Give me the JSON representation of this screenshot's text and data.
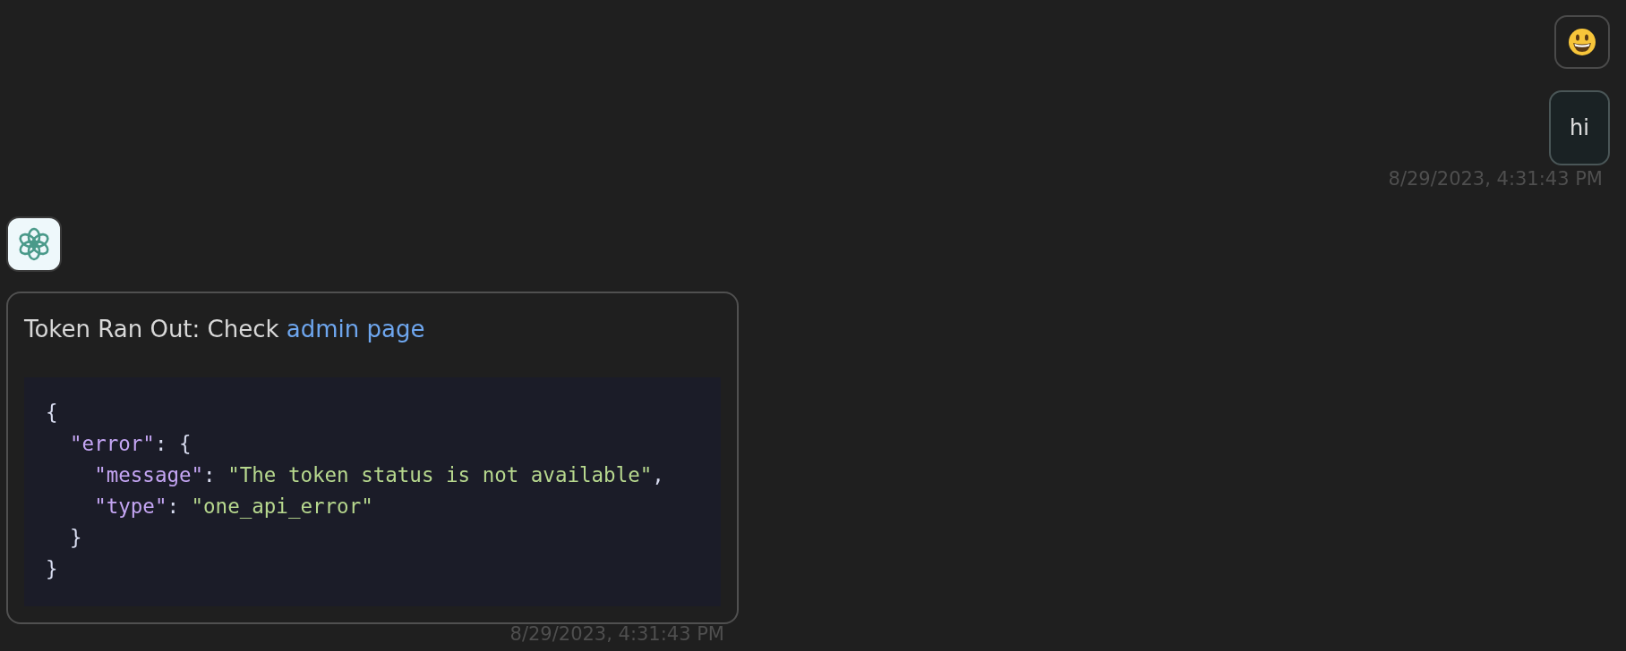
{
  "messages": [
    {
      "kind": "user",
      "text": "hi",
      "time": "8/29/2023, 4:31:43 PM"
    },
    {
      "kind": "assistant",
      "text": "Token Ran Out: Check ",
      "link": "admin page",
      "time": "8/29/2023, 4:31:43 PM",
      "code": [
        {
          "tokens": [
            {
              "kind": "punct",
              "text": "{"
            }
          ],
          "children": [
            {
              "tokens": [
                {
                  "kind": "key",
                  "text": "\"error\""
                },
                {
                  "kind": "punct",
                  "text": ": {"
                }
              ],
              "children": [
                {
                  "tokens": [
                    {
                      "kind": "key",
                      "text": "\"message\""
                    },
                    {
                      "kind": "punct",
                      "text": ": "
                    },
                    {
                      "kind": "string",
                      "text": "\"The token status is not available\""
                    },
                    {
                      "kind": "punct",
                      "text": ","
                    }
                  ]
                },
                {
                  "tokens": [
                    {
                      "kind": "key",
                      "text": "\"type\""
                    },
                    {
                      "kind": "punct",
                      "text": ": "
                    },
                    {
                      "kind": "string",
                      "text": "\"one_api_error\""
                    }
                  ]
                }
              ]
            },
            {
              "tokens": [
                {
                  "kind": "punct",
                  "text": "}"
                }
              ]
            }
          ]
        },
        {
          "tokens": [
            {
              "kind": "punct",
              "text": "}"
            }
          ]
        }
      ]
    }
  ]
}
